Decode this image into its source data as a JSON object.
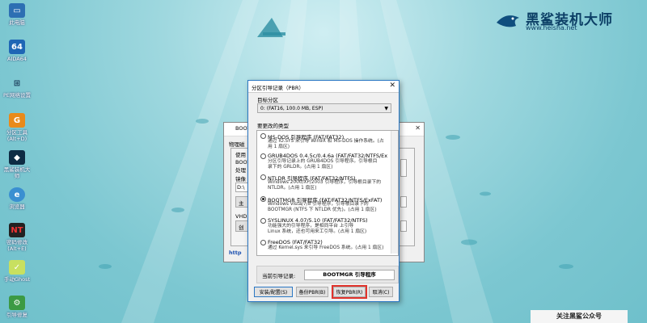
{
  "desktop": {
    "icons": [
      {
        "label": "此电脑",
        "icon": "computer-icon"
      },
      {
        "label": "AIDA64",
        "icon": "aida64-icon"
      },
      {
        "label": "PE网络设置",
        "icon": "network-icon"
      },
      {
        "label": "分区工具\n(Alt+D)",
        "icon": "diskgenius-icon"
      },
      {
        "label": "黑鲨装机大\n师",
        "icon": "shark-icon"
      },
      {
        "label": "浏览器",
        "icon": "browser-icon"
      },
      {
        "label": "密码修改\n(Alt+E)",
        "icon": "password-icon"
      },
      {
        "label": "手动Ghost",
        "icon": "ghost-icon"
      },
      {
        "label": "引导修复",
        "icon": "boot-repair-icon"
      }
    ],
    "brand": {
      "name": "黑鲨装机大师",
      "url": "www.heisha.net"
    },
    "follow_label": "关注黑鲨公众号"
  },
  "back_window": {
    "title": "BOOTI",
    "rows": [
      "物理磁",
      "使用",
      "BOOT",
      "处理",
      "镜像",
      "D:\\",
      "主",
      "VHD",
      "创",
      "http"
    ]
  },
  "dialog": {
    "title": "分区引导记录（PBR）",
    "close": "✕",
    "target_label": "目标分区",
    "target_value": "0: (FAT16, 100.0 MB, ESP)",
    "type_label": "要更改的类型",
    "options": [
      {
        "title": "MS-DOS 引导程序 (FAT/FAT32)",
        "desc": "通过 IO.SYS 来引导 Win9X 和 MS-DOS 操作系统。(占\n用 1 扇区)",
        "selected": false
      },
      {
        "title": "GRUB4DOS 0.4.5c/0.4.6a (FAT/FAT32/NTFS/Ex",
        "desc": "分区引导记录上的 GRUB4DOS 引导程序。引导根目\n录下的 GRLDR。(占用 1 扇区)",
        "selected": false
      },
      {
        "title": "NTLDR 引导程序 (FAT/FAT32/NTFS)",
        "desc": "Windows 2000/XP/2003 引导程序，引导根目录下的\nNTLDR。(占用 1 扇区)",
        "selected": false
      },
      {
        "title": "BOOTMGR 引导程序 (FAT/FAT32/NTFS/ExFAT)",
        "desc": "Windows Vista/7/8 引导程序，引导根目录下的\nBOOTMGR (NTFS 下 NTLDR 优先)。(占用 1 扇区)",
        "selected": true
      },
      {
        "title": "SYSLINUX 4.07/5.10 (FAT/FAT32/NTFS)",
        "desc": "功能强大的引导程序，是相同平台 上引导\nLinux 系统，还也可用来工引导。(占用 1 扇区)",
        "selected": false
      },
      {
        "title": "FreeDOS (FAT/FAT32)",
        "desc": "通过 Kernel.sys 来引导 FreeDOS 系统。(占用 1 扇区)",
        "selected": false
      }
    ],
    "current_label": "当前引导记录:",
    "current_value": "BOOTMGR 引导程序",
    "buttons": {
      "install": "安装/配置(S)",
      "backup": "备份PBR(B)",
      "restore": "恢复PBR(R)",
      "cancel": "取消(C)"
    }
  }
}
